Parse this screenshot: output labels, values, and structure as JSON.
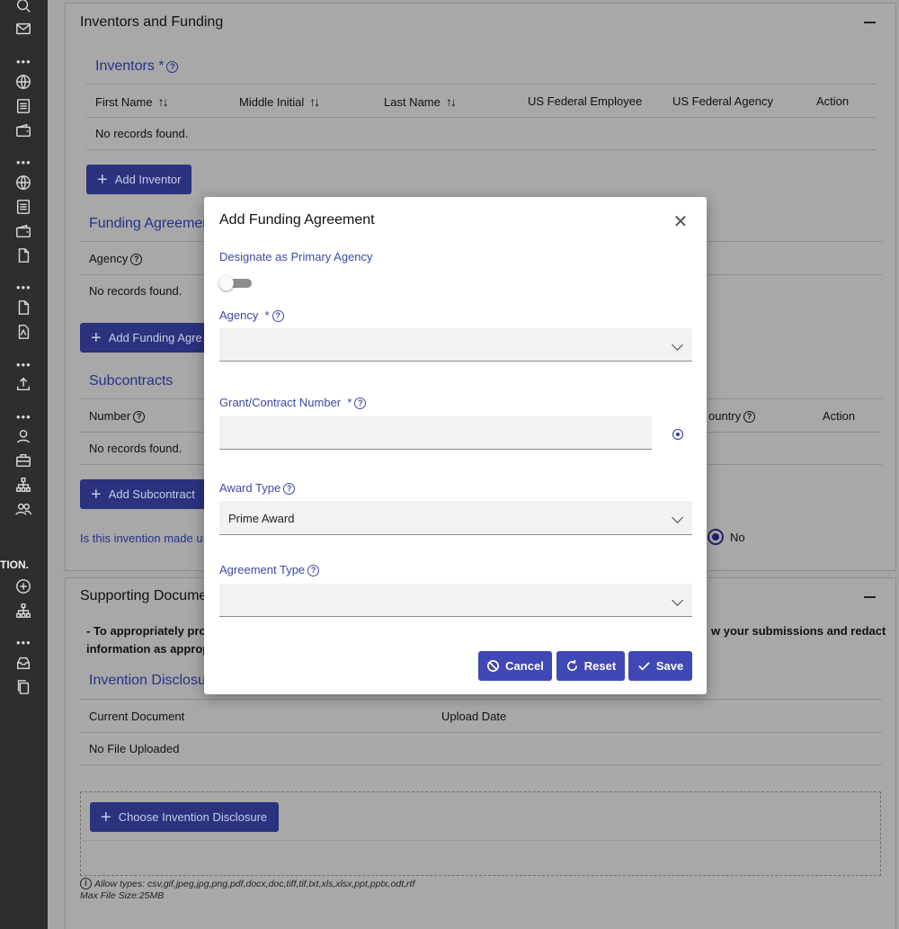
{
  "sidebar": {
    "truncated_label": "TION.",
    "icons": [
      "search-icon",
      "mail-icon",
      "globe-icon",
      "list-icon",
      "wallet-icon",
      "globe-icon",
      "list-icon",
      "wallet-icon",
      "file-icon",
      "file-icon",
      "pdf-icon",
      "upload-icon",
      "user-icon",
      "briefcase-icon",
      "org-chart-icon",
      "users-icon",
      "add-circle-icon",
      "org-chart-icon",
      "inbox-icon",
      "copy-icon"
    ]
  },
  "inventors_funding": {
    "title": "Inventors and Funding",
    "inventors": {
      "title": "Inventors *",
      "columns": [
        "First Name",
        "Middle Initial",
        "Last Name",
        "US Federal Employee",
        "US Federal Agency",
        "Action"
      ],
      "empty": "No records found.",
      "add_button": "Add Inventor"
    },
    "funding": {
      "title": "Funding Agreemen",
      "column_agency": "Agency",
      "empty": "No records found.",
      "add_button": "Add Funding Agre"
    },
    "subcontracts": {
      "title": "Subcontracts",
      "column_number": "Number",
      "column_country": "ountry",
      "column_action": "Action",
      "empty": "No records found.",
      "add_button": "Add Subcontract"
    },
    "question": "Is this invention made u",
    "radio_no": "No"
  },
  "supporting_docs": {
    "title": "Supporting Docume",
    "instruction_left_1": "- To appropriately prote",
    "instruction_right_1": "w your submissions and redact",
    "instruction_left_2": "information as appropr",
    "disclosure_title": "Invention Disclosu",
    "col_current": "Current Document",
    "col_upload": "Upload Date",
    "no_file": "No File Uploaded",
    "choose_button": "Choose Invention Disclosure",
    "allow_types": "Allow types: csv,gif,jpeg,jpg,png,pdf,docx,doc,tiff,tif,txt,xls,xlsx,ppt,pptx,odt,rtf",
    "max_size": "Max File Size:25MB"
  },
  "modal": {
    "title": "Add Funding Agreement",
    "primary_label": "Designate as Primary Agency",
    "primary_on": false,
    "agency_label": "Agency",
    "agency_value": "",
    "grant_label": "Grant/Contract Number",
    "grant_value": "",
    "award_label": "Award Type",
    "award_value": "Prime Award",
    "agreement_label": "Agreement Type",
    "agreement_value": "",
    "required_mark": "*",
    "buttons": {
      "cancel": "Cancel",
      "reset": "Reset",
      "save": "Save"
    }
  },
  "colors": {
    "primary": "#3f48b5",
    "label_blue": "#3f48a8",
    "sidebar": "#2e2e2e"
  }
}
